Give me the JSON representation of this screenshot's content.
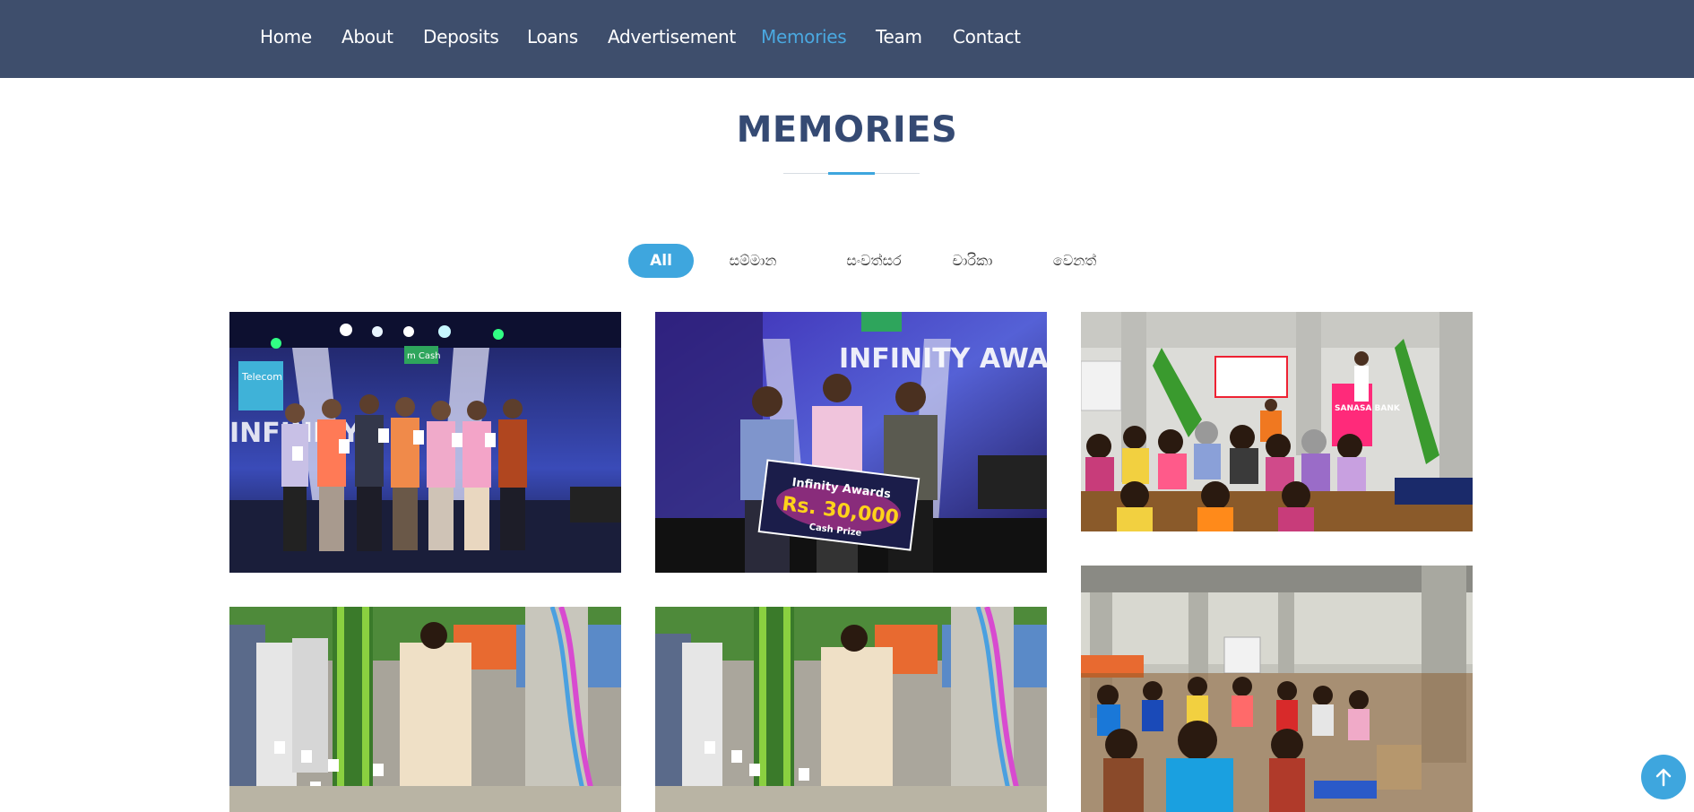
{
  "nav": {
    "items": [
      {
        "label": "Home"
      },
      {
        "label": "About"
      },
      {
        "label": "Deposits"
      },
      {
        "label": "Loans"
      },
      {
        "label": "Advertisement"
      },
      {
        "label": "Memories"
      },
      {
        "label": "Team"
      },
      {
        "label": "Contact"
      }
    ],
    "active": "Memories"
  },
  "section": {
    "title": "MEMORIES"
  },
  "filters": [
    {
      "label": "All",
      "active": true
    },
    {
      "label": "සම්මාන",
      "active": false
    },
    {
      "label": "සංවත්සර",
      "active": false
    },
    {
      "label": "චාරිකා",
      "active": false
    },
    {
      "label": "වෙනත්",
      "active": false
    }
  ],
  "gallery": {
    "photos": [
      {
        "name": "award-group-photo",
        "sign": "m Cash",
        "sign2": "INFINITY"
      },
      {
        "name": "cash-prize-photo",
        "sign": "INFINITY AWARDS",
        "cheque_title": "Infinity Awards",
        "cheque_amount": "Rs. 30,000",
        "cheque_note": "Cash Prize"
      },
      {
        "name": "assembly-speech-photo",
        "banner": "SANASA BANK"
      },
      {
        "name": "lamp-lighting-photo-1"
      },
      {
        "name": "lamp-lighting-photo-2"
      },
      {
        "name": "audience-hall-photo"
      }
    ]
  },
  "colors": {
    "navbar": "#3e4e6c",
    "accent": "#3ea6de",
    "title": "#354a73"
  }
}
